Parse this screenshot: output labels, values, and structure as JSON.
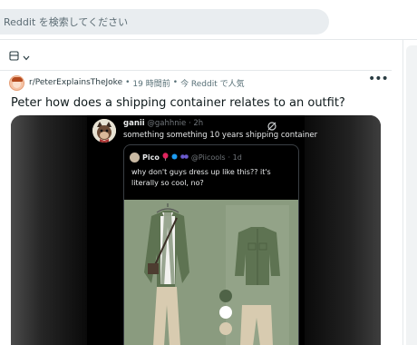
{
  "search": {
    "placeholder": "Reddit を検索してください"
  },
  "post": {
    "subreddit": "r/PeterExplainsTheJoke",
    "time_ago": "19 時間前",
    "separator": "•",
    "popular_label": "今 Reddit で人気",
    "title": "Peter how does a shipping container relates to an outfit?"
  },
  "tweet": {
    "name": "ganii",
    "handle": "@gahhnie",
    "time": "· 2h",
    "text": "something something 10 years shipping container",
    "quote": {
      "name": "Pico",
      "handle": "@Piicools",
      "time": "· 1d",
      "text": "why don't guys dress up like this?? it's literally so cool, no?"
    }
  },
  "colors": {
    "jacket": "#5e7352",
    "pants": "#d8cbb0",
    "backdrop": "#8a9b7f",
    "swatches": [
      "#4f6347",
      "#ffffff",
      "#d8cbb0"
    ]
  }
}
